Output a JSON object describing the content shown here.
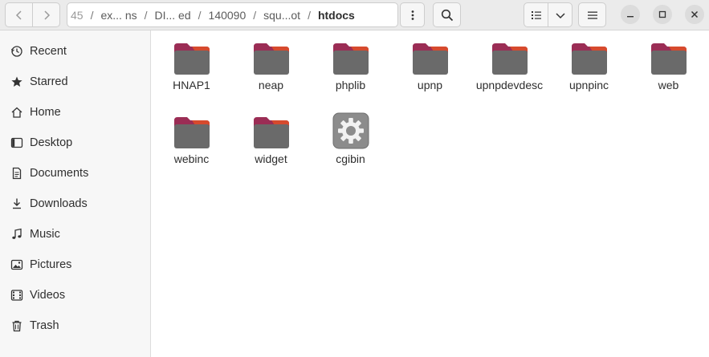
{
  "header": {
    "back_icon": "chevron-left-icon",
    "forward_icon": "chevron-right-icon",
    "breadcrumbs": [
      "45",
      "ex... ns",
      "DI... ed",
      "140090",
      "squ...ot",
      "htdocs"
    ],
    "menu_icon": "vertical-dots-icon",
    "search_icon": "search-icon",
    "view_icon": "list-view-icon",
    "view_dropdown_icon": "chevron-down-icon",
    "main_menu_icon": "hamburger-icon",
    "window": {
      "minimize_icon": "minimize-icon",
      "maximize_icon": "maximize-icon",
      "close_icon": "close-icon"
    }
  },
  "sidebar": {
    "items": [
      {
        "label": "Recent",
        "icon": "clock-icon"
      },
      {
        "label": "Starred",
        "icon": "star-icon"
      },
      {
        "label": "Home",
        "icon": "home-icon"
      },
      {
        "label": "Desktop",
        "icon": "desktop-icon"
      },
      {
        "label": "Documents",
        "icon": "document-icon"
      },
      {
        "label": "Downloads",
        "icon": "download-icon"
      },
      {
        "label": "Music",
        "icon": "music-icon"
      },
      {
        "label": "Pictures",
        "icon": "picture-icon"
      },
      {
        "label": "Videos",
        "icon": "video-icon"
      },
      {
        "label": "Trash",
        "icon": "trash-icon"
      }
    ]
  },
  "files": [
    {
      "name": "HNAP1",
      "type": "folder"
    },
    {
      "name": "neap",
      "type": "folder"
    },
    {
      "name": "phplib",
      "type": "folder"
    },
    {
      "name": "upnp",
      "type": "folder"
    },
    {
      "name": "upnpdevdesc",
      "type": "folder"
    },
    {
      "name": "upnpinc",
      "type": "folder"
    },
    {
      "name": "web",
      "type": "folder"
    },
    {
      "name": "webinc",
      "type": "folder"
    },
    {
      "name": "widget",
      "type": "folder"
    },
    {
      "name": "cgibin",
      "type": "executable"
    }
  ],
  "colors": {
    "folder_tab": "#9b2d55",
    "folder_body": "#6a6a6a",
    "folder_accent": "#e95420"
  }
}
